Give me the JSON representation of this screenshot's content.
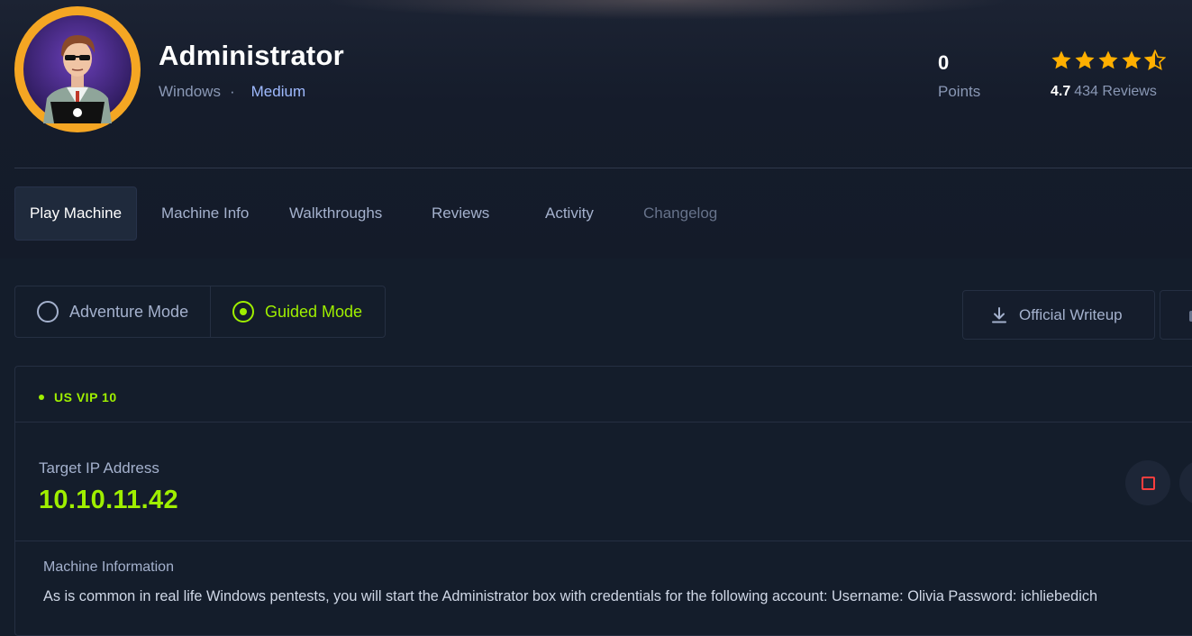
{
  "machine": {
    "name": "Administrator",
    "os": "Windows",
    "separator": "·",
    "difficulty": "Medium"
  },
  "stats": {
    "points_value": "0",
    "points_label": "Points",
    "rating_value": "4.7",
    "reviews_label": "434 Reviews",
    "stars_count": 4.5
  },
  "tabs": [
    {
      "label": "Play Machine",
      "state": "active"
    },
    {
      "label": "Machine Info",
      "state": "normal"
    },
    {
      "label": "Walkthroughs",
      "state": "normal"
    },
    {
      "label": "Reviews",
      "state": "normal"
    },
    {
      "label": "Activity",
      "state": "normal"
    },
    {
      "label": "Changelog",
      "state": "disabled"
    }
  ],
  "modes": {
    "adventure_label": "Adventure Mode",
    "guided_label": "Guided Mode",
    "selected": "Guided Mode"
  },
  "actions": {
    "writeup_label": "Official Writeup",
    "writeup_icon": "download-icon"
  },
  "vpn": {
    "server_label": "US VIP 10",
    "status_color": "#9fef00"
  },
  "target": {
    "ip_label": "Target IP Address",
    "ip_value": "10.10.11.42",
    "stop_icon": "stop-icon"
  },
  "info": {
    "label": "Machine Information",
    "text": "As is common in real life Windows pentests, you will start the Administrator box with credentials for the following account: Username: Olivia Password: ichliebedich"
  },
  "colors": {
    "accent_green": "#9fef00",
    "star_gold": "#ffaf00",
    "avatar_ring": "#f5a623",
    "background": "#141d2b",
    "difficulty_blue": "#9fbaff"
  }
}
